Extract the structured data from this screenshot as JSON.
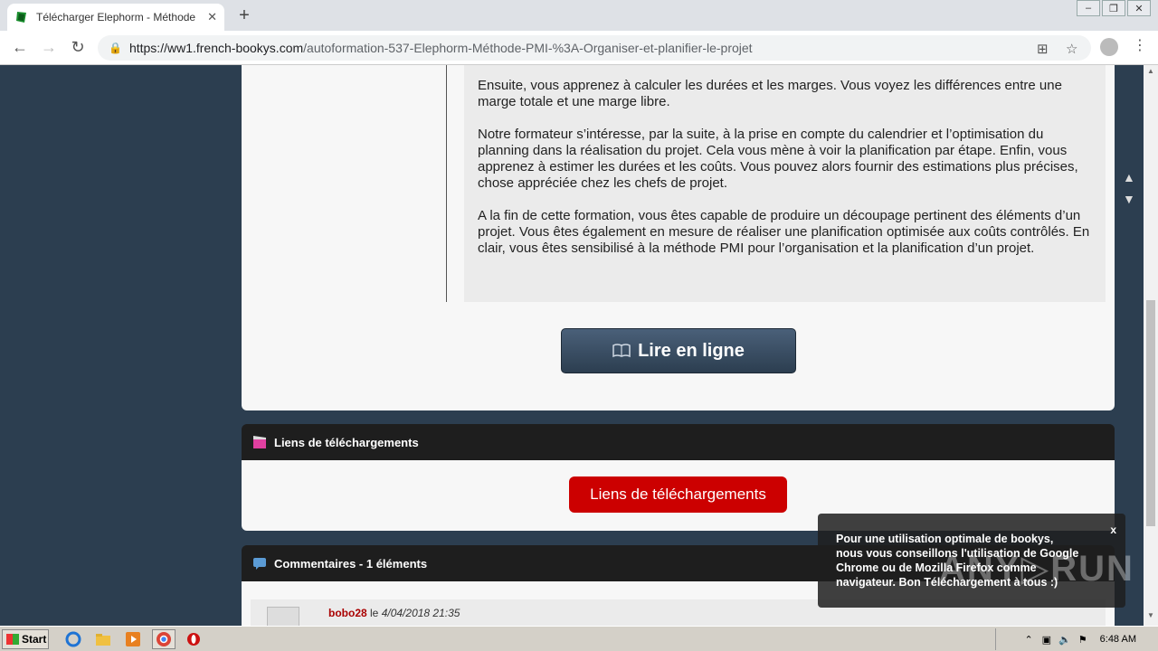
{
  "browser": {
    "tab_title": "Télécharger Elephorm - Méthode PMI",
    "tab_close": "✕",
    "new_tab": "+",
    "url_host": "https://ww1.french-bookys.com",
    "url_path": "/autoformation-537-Elephorm-Méthode-PMI-%3A-Organiser-et-planifier-le-projet"
  },
  "description": {
    "paragraphs": [
      "Ensuite, vous apprenez à calculer les durées et les marges. Vous voyez les différences entre une marge totale et une marge libre.",
      "Notre formateur s’intéresse, par la suite, à la prise en compte du calendrier et l’optimisation du planning dans la réalisation du projet. Cela vous mène à voir la planification par étape. Enfin, vous apprenez à estimer les durées et les coûts. Vous pouvez alors fournir des estimations plus précises, chose appréciée chez les chefs de projet.",
      "A la fin de cette formation, vous êtes capable de produire un découpage pertinent des éléments d’un projet. Vous êtes également en mesure de réaliser une planification optimisée aux coûts contrôlés. En clair, vous êtes sensibilisé à la méthode PMI pour l’organisation et la planification d’un projet."
    ]
  },
  "read_button": "Lire en ligne",
  "downloads": {
    "header": "Liens de téléchargements",
    "button": "Liens de téléchargements"
  },
  "comments": {
    "header": "Commentaires - 1 éléments",
    "user": "bobo28",
    "le": "le",
    "date": "4/04/2018 21:35"
  },
  "toast": {
    "text": "Pour une utilisation optimale de bookys, nous vous conseillons l'utilisation de Google Chrome ou de Mozilla Firefox comme navigateur. Bon Téléchargement à tous :)",
    "close": "x"
  },
  "watermark": "ANY▷RUN",
  "taskbar": {
    "start": "Start",
    "time": "6:48 AM"
  }
}
